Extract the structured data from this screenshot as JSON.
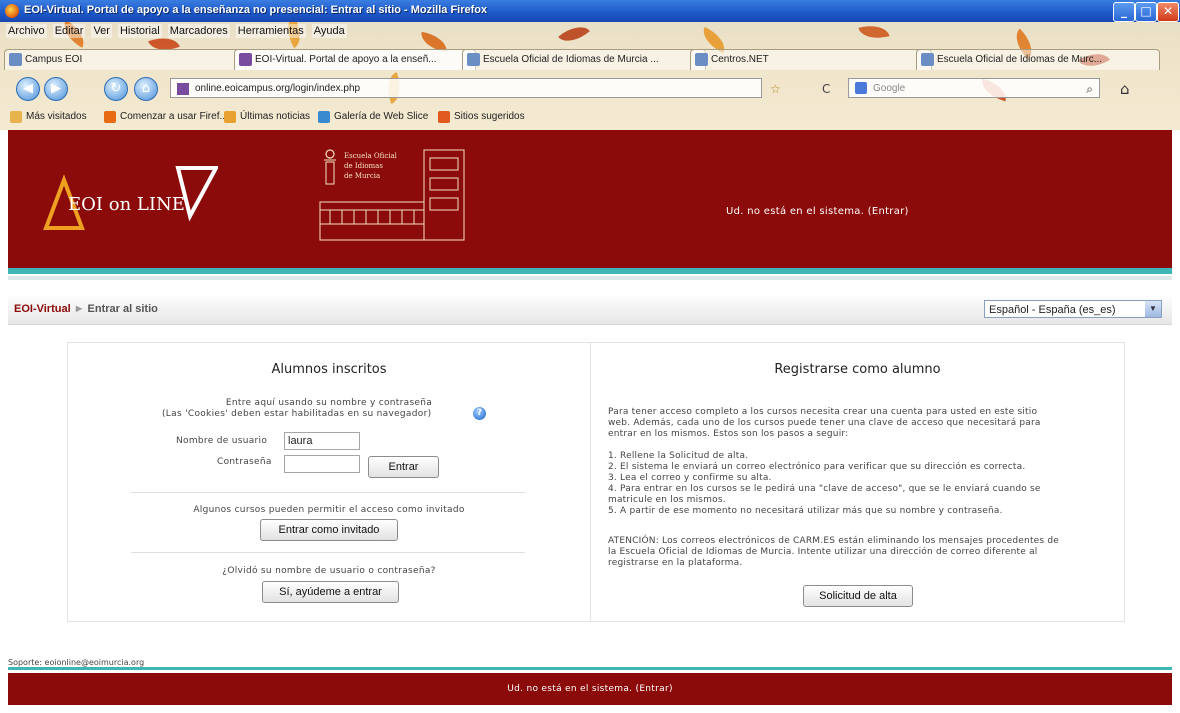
{
  "window": {
    "title": "EOI-Virtual. Portal de apoyo a la enseñanza no presencial: Entrar al sitio - Mozilla Firefox"
  },
  "menubar": [
    "Archivo",
    "Editar",
    "Ver",
    "Historial",
    "Marcadores",
    "Herramientas",
    "Ayuda"
  ],
  "tabs": [
    {
      "label": "Campus EOI",
      "active": false
    },
    {
      "label": "EOI-Virtual. Portal de apoyo a la enseñ...",
      "active": true
    },
    {
      "label": "Escuela Oficial de Idiomas de Murcia ...",
      "active": false
    },
    {
      "label": "Centros.NET",
      "active": false
    },
    {
      "label": "Escuela Oficial de Idiomas de Murc...",
      "active": false
    }
  ],
  "navbar": {
    "url": "online.eoicampus.org/login/index.php",
    "search_placeholder": "Google"
  },
  "bookmarks": [
    "Más visitados",
    "Comenzar a usar Firef...",
    "Últimas noticias",
    "Galería de Web Slice",
    "Sitios sugeridos"
  ],
  "header": {
    "logo_text": "EOI on LINE",
    "school_lines": [
      "Escuela Oficial",
      "de Idiomas",
      "de Murcia"
    ],
    "login_status": "Ud. no está en el sistema. (Entrar)"
  },
  "breadcrumb": {
    "home": "EOI-Virtual",
    "separator": "►",
    "current": "Entrar al sitio"
  },
  "language": {
    "selected": "Español - España (es_es)"
  },
  "login": {
    "heading": "Alumnos inscritos",
    "intro_line1": "Entre aquí usando su nombre y contraseña",
    "intro_line2": "(Las 'Cookies' deben estar habilitadas en su navegador)",
    "username_label": "Nombre de usuario",
    "username_value": "laura",
    "password_label": "Contraseña",
    "password_value": "",
    "submit_label": "Entrar",
    "guest_text": "Algunos cursos pueden permitir el acceso como invitado",
    "guest_button": "Entrar como invitado",
    "forgot_text": "¿Olvidó su nombre de usuario o contraseña?",
    "forgot_button": "Sí, ayúdeme a entrar"
  },
  "signup": {
    "heading": "Registrarse como alumno",
    "intro": "Para tener acceso completo a los cursos necesita crear una cuenta para usted en este sitio web. Además, cada uno de los cursos puede tener una clave de acceso que necesitará para entrar en los mismos. Estos son los pasos a seguir:",
    "steps": [
      "1. Rellene la Solicitud de alta.",
      "2. El sistema le enviará un correo electrónico para verificar que su dirección es correcta.",
      "3. Lea el correo y confirme su alta.",
      "4. Para entrar en los cursos se le pedirá una \"clave de acceso\", que se le enviará cuando se matricule en los mismos.",
      "5. A partir de ese momento no necesitará utilizar más que su nombre y contraseña."
    ],
    "notice": "ATENCIÓN: Los correos electrónicos de CARM.ES están eliminando los mensajes procedentes de la Escuela Oficial de Idiomas de Murcia. Intente utilizar una dirección de correo diferente al registrarse en la plataforma.",
    "button": "Solicitud de alta"
  },
  "footer": {
    "contact": "Soporte: eoionline@eoimurcia.org",
    "login_status": "Ud. no está en el sistema. (Entrar)"
  }
}
